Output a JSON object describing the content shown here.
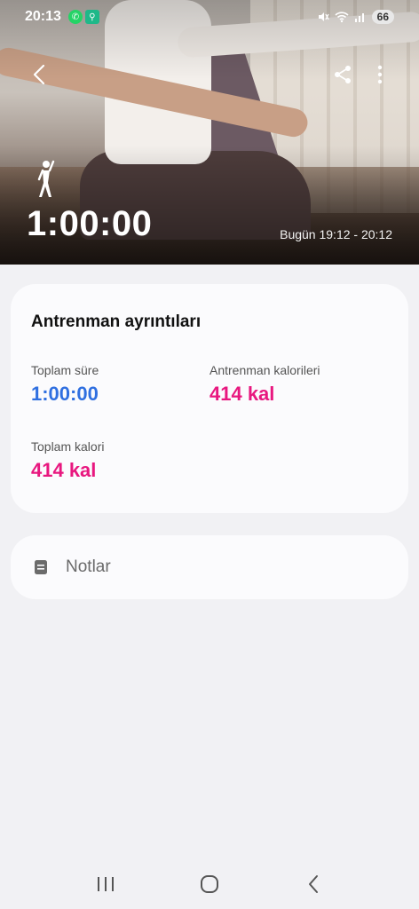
{
  "status": {
    "time": "20:13",
    "battery": "66",
    "notif_icons": [
      "whatsapp-icon",
      "fitness-app-icon"
    ],
    "right_icons": [
      "mute-icon",
      "wifi-icon",
      "signal-icon"
    ],
    "colors": {
      "whatsapp": "#25d366",
      "fitness": "#1fb889"
    }
  },
  "header": {
    "workout_icon": "yoga-pose-icon",
    "duration": "1:00:00",
    "time_range": "Bugün 19:12 - 20:12"
  },
  "details": {
    "title": "Antrenman ayrıntıları",
    "total_time_label": "Toplam süre",
    "total_time_value": "1:00:00",
    "workout_calories_label": "Antrenman kalorileri",
    "workout_calories_value": "414 kal",
    "total_calories_label": "Toplam kalori",
    "total_calories_value": "414 kal",
    "colors": {
      "time": "#2f6fe0",
      "calories": "#e8177f"
    }
  },
  "notes": {
    "label": "Notlar",
    "icon": "note-icon"
  },
  "nav": {
    "icons": [
      "recent-apps-icon",
      "home-icon",
      "back-icon"
    ]
  }
}
